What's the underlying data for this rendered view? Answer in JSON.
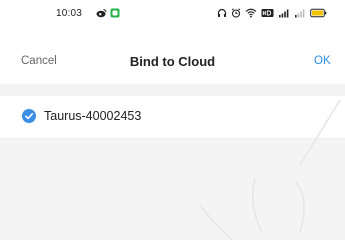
{
  "status_bar": {
    "time": "10:03",
    "icons": [
      "weibo-icon",
      "green-app-icon",
      "headphones-icon",
      "alarm-icon",
      "wifi-icon",
      "hd-icon",
      "signal-4g-icon",
      "signal-icon",
      "battery-icon"
    ]
  },
  "nav": {
    "cancel_label": "Cancel",
    "title": "Bind to Cloud",
    "ok_label": "OK"
  },
  "device_list": {
    "items": [
      {
        "name": "Taurus-40002453",
        "selected": true
      }
    ]
  },
  "colors": {
    "accent": "#3a8ee6",
    "ok_text": "#2f8fe8",
    "background_gray": "#f4f4f4",
    "battery": "#f2c200",
    "app_icon_green": "#22b14c"
  }
}
